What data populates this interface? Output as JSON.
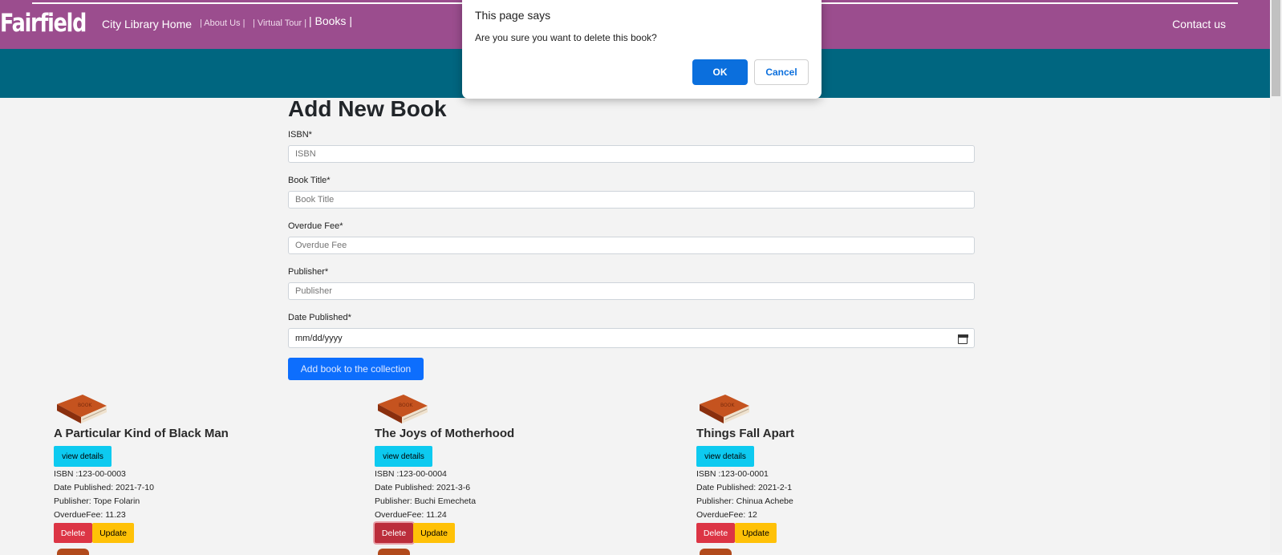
{
  "nav": {
    "brand": "Fairfield",
    "home": "City Library Home",
    "about": "| About Us |",
    "tour": "| Virtual Tour |",
    "books": "| Books |",
    "contact": "Contact us"
  },
  "form": {
    "title": "Add New Book",
    "isbn_label": "ISBN*",
    "isbn_placeholder": "ISBN",
    "title_label": "Book Title*",
    "title_placeholder": "Book Title",
    "fee_label": "Overdue Fee*",
    "fee_placeholder": "Overdue Fee",
    "publisher_label": "Publisher*",
    "publisher_placeholder": "Publisher",
    "date_label": "Date Published*",
    "date_placeholder": "mm/dd/yyyy",
    "submit": "Add book to the collection"
  },
  "books": [
    {
      "title": "A Particular Kind of Black Man",
      "view": "view details",
      "isbn": "ISBN :123-00-0003",
      "date": "Date Published: 2021-7-10",
      "publisher": "Publisher: Tope Folarin",
      "fee": "OverdueFee: 11.23",
      "delete": "Delete",
      "update": "Update"
    },
    {
      "title": "The Joys of Motherhood",
      "view": "view details",
      "isbn": "ISBN :123-00-0004",
      "date": "Date Published: 2021-3-6",
      "publisher": "Publisher: Buchi Emecheta",
      "fee": "OverdueFee: 11.24",
      "delete": "Delete",
      "update": "Update"
    },
    {
      "title": "Things Fall Apart",
      "view": "view details",
      "isbn": "ISBN :123-00-0001",
      "date": "Date Published: 2021-2-1",
      "publisher": "Publisher: Chinua Achebe",
      "fee": "OverdueFee: 12",
      "delete": "Delete",
      "update": "Update"
    }
  ],
  "dialog": {
    "title": "This page says",
    "message": "Are you sure you want to delete this book?",
    "ok": "OK",
    "cancel": "Cancel"
  },
  "colors": {
    "nav_bg": "#9b4d8e",
    "banner_bg": "#006680",
    "primary": "#0d6efd",
    "info": "#0dcaf0",
    "danger": "#dc3545",
    "warning": "#ffc107"
  },
  "icons": [
    "book-icon",
    "calendar-icon"
  ]
}
